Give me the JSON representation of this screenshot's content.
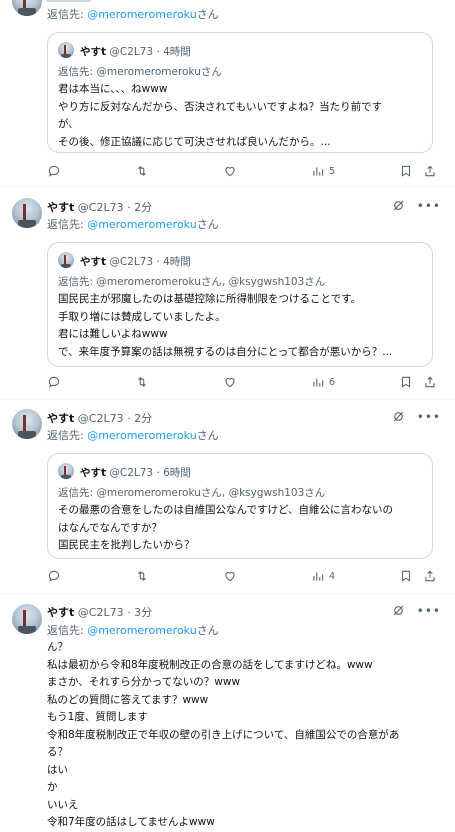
{
  "posts": [
    {
      "reply_prefix": "返信先: ",
      "reply_to": "@meromeromeroku",
      "reply_suffix": "さん",
      "quote": {
        "name": "やすt",
        "handle": "@C2L73",
        "time": "4時間",
        "reply_prefix": "返信先: ",
        "reply_to": "@meromeromeroku",
        "reply_suffix": "さん",
        "lines": [
          "君は本当に、、、ねwww",
          "やり方に反対なんだから、否決されてもいいですよね？当たり前です",
          "が、",
          "その後、修正協議に応じて可決させれば良いんだから。..."
        ]
      },
      "views": "5"
    },
    {
      "name": "やすt",
      "handle": "@C2L73",
      "time": "2分",
      "reply_prefix": "返信先: ",
      "reply_to": "@meromeromeroku",
      "reply_suffix": "さん",
      "quote": {
        "name": "やすt",
        "handle": "@C2L73",
        "time": "4時間",
        "reply_prefix": "返信先: ",
        "reply_to": "@meromeromeroku",
        "reply_suffix": "さん, @ksygwsh103さん",
        "lines": [
          "国民民主が邪魔したのは基礎控除に所得制限をつけることです。",
          "手取り増には賛成していましたよ。",
          "君には難しいよねwww",
          "で、来年度予算案の話は無視するのは自分にとって都合が悪いから？..."
        ]
      },
      "views": "6"
    },
    {
      "name": "やすt",
      "handle": "@C2L73",
      "time": "2分",
      "reply_prefix": "返信先: ",
      "reply_to": "@meromeromeroku",
      "reply_suffix": "さん",
      "quote": {
        "name": "やすt",
        "handle": "@C2L73",
        "time": "6時間",
        "reply_prefix": "返信先: ",
        "reply_to": "@meromeromeroku",
        "reply_suffix": "さん, @ksygwsh103さん",
        "lines": [
          "その最悪の合意をしたのは自維国公なんですけど、自維公に言わないの",
          "はなんでなんですか？",
          "国民民主を批判したいから？"
        ]
      },
      "views": "4"
    },
    {
      "name": "やすt",
      "handle": "@C2L73",
      "time": "3分",
      "reply_prefix": "返信先: ",
      "reply_to": "@meromeromeroku",
      "reply_suffix": "さん",
      "lines": [
        "ん？",
        "私は最初から令和8年度税制改正の合意の話をしてますけどね。www",
        "まさか、それすら分かってないの？www",
        "私のどの質問に答えてます？www",
        "もう1度、質問します",
        "令和8年度税制改正で年収の壁の引き上げについて、自維国公での合意があ",
        "る？",
        "はい",
        "か",
        "いいえ",
        "令和7年度の話はしてませんよwww"
      ]
    }
  ],
  "colors": {
    "accent": "#1d9bf0",
    "muted": "#536471",
    "border": "#cfd9de"
  }
}
